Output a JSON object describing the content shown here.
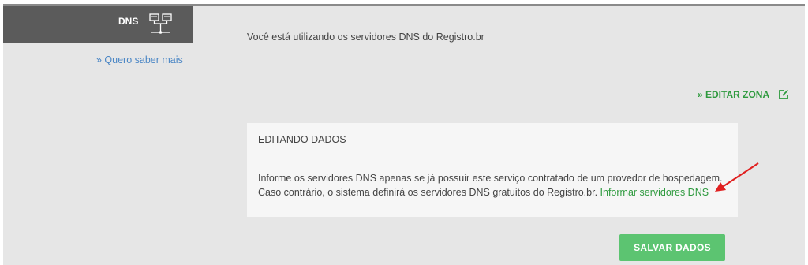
{
  "sidebar": {
    "tab_label": "DNS",
    "more_link": "» Quero saber mais"
  },
  "main": {
    "intro": "Você está utilizando os servidores DNS do Registro.br",
    "edit_zone_label": "» EDITAR ZONA"
  },
  "panel": {
    "title": "EDITANDO DADOS",
    "line1": "Informe os servidores DNS apenas se já possuir este serviço contratado de um provedor de hospedagem.",
    "line2": "Caso contrário, o sistema definirá os servidores DNS gratuitos do Registro.br. ",
    "link": "Informar servidores DNS"
  },
  "actions": {
    "save_label": "SALVAR DADOS"
  },
  "icons": {
    "dns": "network-servers-icon",
    "edit": "edit-icon",
    "annotation": "red-arrow-icon"
  },
  "colors": {
    "accent_green": "#2e9a3e",
    "button_green": "#5cc471",
    "link_blue": "#4a86c5",
    "tab_dark": "#5b5b5b",
    "annotation_red": "#e02020"
  }
}
